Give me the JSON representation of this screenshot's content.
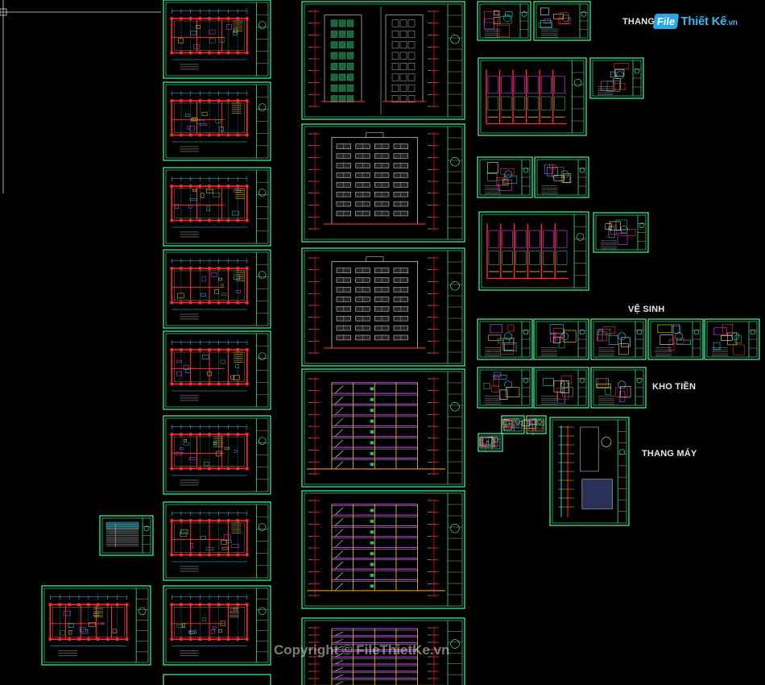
{
  "viewport": {
    "background": "#000000"
  },
  "labels": {
    "thang": "THANG",
    "ve_sinh": "VỆ SINH",
    "kho_tien": "KHO TIỀN",
    "thang_may": "THANG MÁY"
  },
  "logo": {
    "box_text": "File",
    "text": "Thiết Kế",
    "suffix": ".vn"
  },
  "watermark": "Copyright © FileThietKe.vn",
  "colors": {
    "frame": "#3cff9e",
    "title_block": "#e6e6e6",
    "wall": "#ff2a2a",
    "dim": "#22d3ee",
    "accent_yellow": "#ffd21f",
    "accent_orange": "#ff8a1c",
    "accent_magenta": "#e040fb",
    "hatch_green": "#2eb872",
    "logo_blue": "#2aa7e6"
  }
}
